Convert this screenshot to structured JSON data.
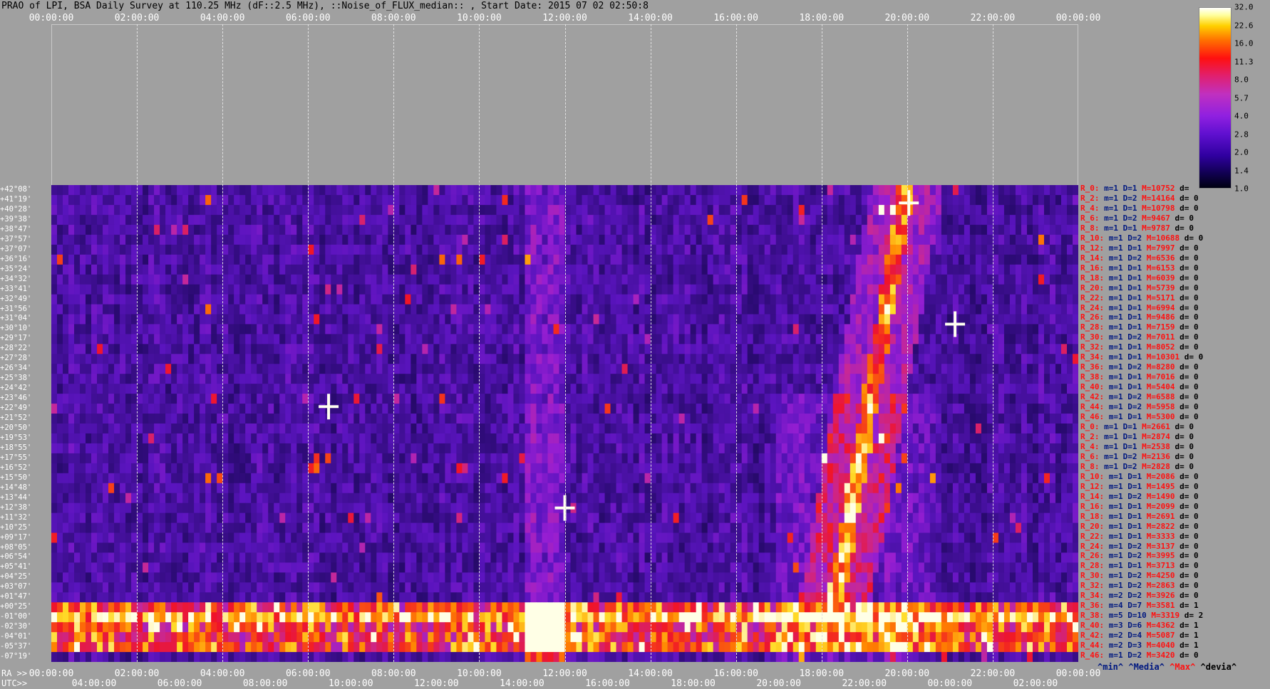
{
  "title": "PRAO of LPI, BSA Daily Survey at 110.25 MHz (dF::2.5 MHz), ::Noise_of_FLUX_median:: , Start Date: 2015 07 02 02:50:8",
  "top_ticks": [
    "00:00:00",
    "02:00:00",
    "04:00:00",
    "06:00:00",
    "08:00:00",
    "10:00:00",
    "12:00:00",
    "14:00:00",
    "16:00:00",
    "18:00:00",
    "20:00:00",
    "22:00:00",
    "00:00:00"
  ],
  "ra_label": "RA >>",
  "ra_ticks": [
    "00:00:00",
    "02:00:00",
    "04:00:00",
    "06:00:00",
    "08:00:00",
    "10:00:00",
    "12:00:00",
    "14:00:00",
    "16:00:00",
    "18:00:00",
    "20:00:00",
    "22:00:00",
    "00:00:00"
  ],
  "utc_label": "UTC>>",
  "utc_ticks": [
    "04:00:00",
    "06:00:00",
    "08:00:00",
    "10:00:00",
    "12:00:00",
    "14:00:00",
    "16:00:00",
    "18:00:00",
    "20:00:00",
    "22:00:00",
    "00:00:00",
    "02:00:00"
  ],
  "colorbar": {
    "labels": [
      "32.0",
      "22.6",
      "16.0",
      "11.3",
      "8.0",
      "5.7",
      "4.0",
      "2.8",
      "2.0",
      "1.4",
      "1.0"
    ]
  },
  "legend": {
    "min": "^min^",
    "media": "^Media^",
    "max": "^Max^",
    "devia": "^devia^"
  },
  "chart_data": {
    "type": "heatmap",
    "title": "PRAO of LPI, BSA Daily Survey at 110.25 MHz (dF::2.5 MHz), ::Noise_of_FLUX_median:: , Start Date: 2015 07 02 02:50:8",
    "xlabel": "RA >>",
    "x2label": "UTC>>",
    "xlim": [
      "00:00:00",
      "00:00:00"
    ],
    "color_scale": {
      "min": 1.0,
      "max": 32.0,
      "scale": "log"
    },
    "declinations": [
      "+42°08'",
      "+41°19'",
      "+40°28'",
      "+39°38'",
      "+38°47'",
      "+37°57'",
      "+37°07'",
      "+36°16'",
      "+35°24'",
      "+34°32'",
      "+33°41'",
      "+32°49'",
      "+31°56'",
      "+31°04'",
      "+30°10'",
      "+29°17'",
      "+28°22'",
      "+27°28'",
      "+26°34'",
      "+25°38'",
      "+24°42'",
      "+23°46'",
      "+22°49'",
      "+21°52'",
      "+20°50'",
      "+19°53'",
      "+18°55'",
      "+17°55'",
      "+16°52'",
      "+15°50'",
      "+14°48'",
      "+13°44'",
      "+12°38'",
      "+11°32'",
      "+10°25'",
      "+09°17'",
      "+08°05'",
      "+06°54'",
      "+05°41'",
      "+04°25'",
      "+03°07'",
      "+01°47'",
      "+00°25'",
      "-01°00'",
      "-02°30'",
      "-04°01'",
      "-05°37'",
      "-07°19'"
    ],
    "row_stats": [
      {
        "r": "R_0:",
        "m": "m=1",
        "D": "D=1",
        "M": "M=10752",
        "d": "d="
      },
      {
        "r": "R_2:",
        "m": "m=1",
        "D": "D=2",
        "M": "M=14164",
        "d": "d= 0"
      },
      {
        "r": "R_4:",
        "m": "m=1",
        "D": "D=1",
        "M": "M=10798",
        "d": "d= 0"
      },
      {
        "r": "R_6:",
        "m": "m=1",
        "D": "D=2",
        "M": "M=9467",
        "d": "d= 0"
      },
      {
        "r": "R_8:",
        "m": "m=1",
        "D": "D=1",
        "M": "M=9787",
        "d": "d= 0"
      },
      {
        "r": "R_10:",
        "m": "m=1",
        "D": "D=2",
        "M": "M=10688",
        "d": "d= 0"
      },
      {
        "r": "R_12:",
        "m": "m=1",
        "D": "D=1",
        "M": "M=7997",
        "d": "d= 0"
      },
      {
        "r": "R_14:",
        "m": "m=1",
        "D": "D=2",
        "M": "M=6536",
        "d": "d= 0"
      },
      {
        "r": "R_16:",
        "m": "m=1",
        "D": "D=1",
        "M": "M=6153",
        "d": "d= 0"
      },
      {
        "r": "R_18:",
        "m": "m=1",
        "D": "D=1",
        "M": "M=6039",
        "d": "d= 0"
      },
      {
        "r": "R_20:",
        "m": "m=1",
        "D": "D=1",
        "M": "M=5739",
        "d": "d= 0"
      },
      {
        "r": "R_22:",
        "m": "m=1",
        "D": "D=1",
        "M": "M=5171",
        "d": "d= 0"
      },
      {
        "r": "R_24:",
        "m": "m=1",
        "D": "D=1",
        "M": "M=6994",
        "d": "d= 0"
      },
      {
        "r": "R_26:",
        "m": "m=1",
        "D": "D=1",
        "M": "M=9486",
        "d": "d= 0"
      },
      {
        "r": "R_28:",
        "m": "m=1",
        "D": "D=1",
        "M": "M=7159",
        "d": "d= 0"
      },
      {
        "r": "R_30:",
        "m": "m=1",
        "D": "D=2",
        "M": "M=7011",
        "d": "d= 0"
      },
      {
        "r": "R_32:",
        "m": "m=1",
        "D": "D=1",
        "M": "M=8052",
        "d": "d= 0"
      },
      {
        "r": "R_34:",
        "m": "m=1",
        "D": "D=1",
        "M": "M=10301",
        "d": "d= 0"
      },
      {
        "r": "R_36:",
        "m": "m=1",
        "D": "D=2",
        "M": "M=8280",
        "d": "d= 0"
      },
      {
        "r": "R_38:",
        "m": "m=1",
        "D": "D=1",
        "M": "M=7016",
        "d": "d= 0"
      },
      {
        "r": "R_40:",
        "m": "m=1",
        "D": "D=1",
        "M": "M=5404",
        "d": "d= 0"
      },
      {
        "r": "R_42:",
        "m": "m=1",
        "D": "D=2",
        "M": "M=6588",
        "d": "d= 0"
      },
      {
        "r": "R_44:",
        "m": "m=1",
        "D": "D=2",
        "M": "M=5958",
        "d": "d= 0"
      },
      {
        "r": "R_46:",
        "m": "m=1",
        "D": "D=1",
        "M": "M=5300",
        "d": "d= 0"
      },
      {
        "r": "R_0:",
        "m": "m=1",
        "D": "D=1",
        "M": "M=2661",
        "d": "d= 0"
      },
      {
        "r": "R_2:",
        "m": "m=1",
        "D": "D=1",
        "M": "M=2874",
        "d": "d= 0"
      },
      {
        "r": "R_4:",
        "m": "m=1",
        "D": "D=1",
        "M": "M=2538",
        "d": "d= 0"
      },
      {
        "r": "R_6:",
        "m": "m=1",
        "D": "D=2",
        "M": "M=2136",
        "d": "d= 0"
      },
      {
        "r": "R_8:",
        "m": "m=1",
        "D": "D=2",
        "M": "M=2828",
        "d": "d= 0"
      },
      {
        "r": "R_10:",
        "m": "m=1",
        "D": "D=1",
        "M": "M=2086",
        "d": "d= 0"
      },
      {
        "r": "R_12:",
        "m": "m=1",
        "D": "D=1",
        "M": "M=1495",
        "d": "d= 0"
      },
      {
        "r": "R_14:",
        "m": "m=1",
        "D": "D=2",
        "M": "M=1490",
        "d": "d= 0"
      },
      {
        "r": "R_16:",
        "m": "m=1",
        "D": "D=1",
        "M": "M=2099",
        "d": "d= 0"
      },
      {
        "r": "R_18:",
        "m": "m=1",
        "D": "D=1",
        "M": "M=2691",
        "d": "d= 0"
      },
      {
        "r": "R_20:",
        "m": "m=1",
        "D": "D=1",
        "M": "M=2822",
        "d": "d= 0"
      },
      {
        "r": "R_22:",
        "m": "m=1",
        "D": "D=1",
        "M": "M=3333",
        "d": "d= 0"
      },
      {
        "r": "R_24:",
        "m": "m=1",
        "D": "D=2",
        "M": "M=3137",
        "d": "d= 0"
      },
      {
        "r": "R_26:",
        "m": "m=1",
        "D": "D=2",
        "M": "M=3995",
        "d": "d= 0"
      },
      {
        "r": "R_28:",
        "m": "m=1",
        "D": "D=1",
        "M": "M=3713",
        "d": "d= 0"
      },
      {
        "r": "R_30:",
        "m": "m=1",
        "D": "D=2",
        "M": "M=4250",
        "d": "d= 0"
      },
      {
        "r": "R_32:",
        "m": "m=1",
        "D": "D=2",
        "M": "M=2863",
        "d": "d= 0"
      },
      {
        "r": "R_34:",
        "m": "m=2",
        "D": "D=2",
        "M": "M=3926",
        "d": "d= 0"
      },
      {
        "r": "R_36:",
        "m": "m=4",
        "D": "D=7",
        "M": "M=3581",
        "d": "d= 1"
      },
      {
        "r": "R_38:",
        "m": "m=5",
        "D": "D=10",
        "M": "M=3319",
        "d": "d= 2"
      },
      {
        "r": "R_40:",
        "m": "m=3",
        "D": "D=6",
        "M": "M=4362",
        "d": "d= 1"
      },
      {
        "r": "R_42:",
        "m": "m=2",
        "D": "D=4",
        "M": "M=5087",
        "d": "d= 1"
      },
      {
        "r": "R_44:",
        "m": "m=2",
        "D": "D=3",
        "M": "M=4040",
        "d": "d= 1"
      },
      {
        "r": "R_46:",
        "m": "m=1",
        "D": "D=2",
        "M": "M=3420",
        "d": "d= 0"
      }
    ]
  }
}
